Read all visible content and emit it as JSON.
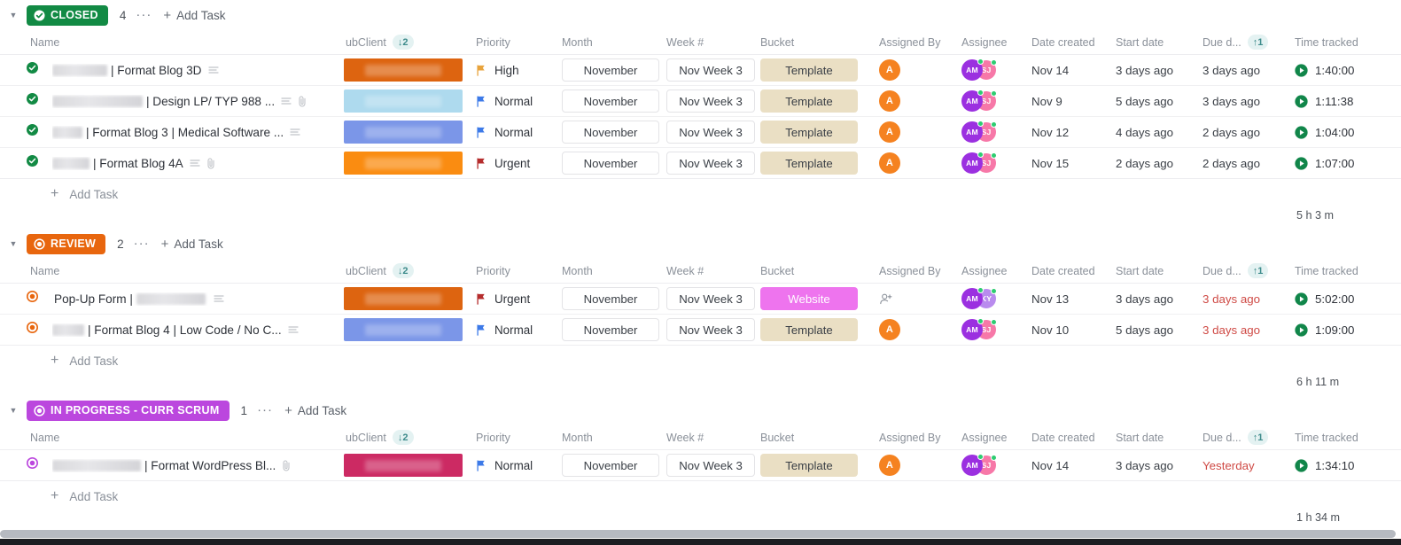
{
  "columns": {
    "name": "Name",
    "subclient": "ubClient",
    "subclient_sort": "↓2",
    "priority": "Priority",
    "month": "Month",
    "week": "Week #",
    "bucket": "Bucket",
    "assigned_by": "Assigned By",
    "assignee": "Assignee",
    "date_created": "Date created",
    "start_date": "Start date",
    "due_date": "Due d...",
    "due_sort": "↑1",
    "time_tracked": "Time tracked"
  },
  "labels": {
    "add_task": "Add Task",
    "dots": "···"
  },
  "colors": {
    "closed": "#128A44",
    "review": "#E8660E",
    "in_progress": "#BB47DE",
    "template_bucket_bg": "#EADFC4",
    "template_bucket_fg": "#3a3f46",
    "website_bucket_bg": "#EE74EE",
    "website_bucket_fg": "#ffffff",
    "overdue": "#cf4a45",
    "play_green": "#11864A",
    "sort_badge": "#3d8b8b"
  },
  "groups": [
    {
      "status": "CLOSED",
      "status_icon": "check-circle-icon",
      "count": "4",
      "total_time": "5 h 3 m",
      "tasks": [
        {
          "redact_width": 62,
          "name": "| Format Blog 3D",
          "has_description": true,
          "has_attachment": false,
          "subclient_color": "#DD6410",
          "priority": "High",
          "priority_color": "#E8A33D",
          "month": "November",
          "week": "Nov Week 3",
          "bucket": "Template",
          "bucket_type": "template",
          "assigned_by": "A",
          "assignees": [
            "AM",
            "SJ"
          ],
          "date_created": "Nov 14",
          "start_date": "3 days ago",
          "due_date": "3 days ago",
          "due_overdue": false,
          "time_tracked": "1:40:00"
        },
        {
          "redact_width": 102,
          "name": "| Design LP/ TYP 988 ...",
          "has_description": true,
          "has_attachment": true,
          "subclient_color": "#AEDAEE",
          "priority": "Normal",
          "priority_color": "#3D7AE8",
          "month": "November",
          "week": "Nov Week 3",
          "bucket": "Template",
          "bucket_type": "template",
          "assigned_by": "A",
          "assignees": [
            "AM",
            "SJ"
          ],
          "date_created": "Nov 9",
          "start_date": "5 days ago",
          "due_date": "3 days ago",
          "due_overdue": false,
          "time_tracked": "1:11:38"
        },
        {
          "redact_width": 34,
          "name": "| Format Blog 3 | Medical Software ...",
          "has_description": true,
          "has_attachment": false,
          "subclient_color": "#7B96E8",
          "priority": "Normal",
          "priority_color": "#3D7AE8",
          "month": "November",
          "week": "Nov Week 3",
          "bucket": "Template",
          "bucket_type": "template",
          "assigned_by": "A",
          "assignees": [
            "AM",
            "SJ"
          ],
          "date_created": "Nov 12",
          "start_date": "4 days ago",
          "due_date": "2 days ago",
          "due_overdue": false,
          "time_tracked": "1:04:00"
        },
        {
          "redact_width": 42,
          "name": "| Format Blog 4A",
          "has_description": true,
          "has_attachment": true,
          "subclient_color": "#FA8C11",
          "priority": "Urgent",
          "priority_color": "#B52D2D",
          "month": "November",
          "week": "Nov Week 3",
          "bucket": "Template",
          "bucket_type": "template",
          "assigned_by": "A",
          "assignees": [
            "AM",
            "SJ"
          ],
          "date_created": "Nov 15",
          "start_date": "2 days ago",
          "due_date": "2 days ago",
          "due_overdue": false,
          "time_tracked": "1:07:00"
        }
      ]
    },
    {
      "status": "REVIEW",
      "status_icon": "ring-circle-icon",
      "count": "2",
      "total_time": "6 h 11 m",
      "tasks": [
        {
          "prefix": "Pop-Up Form |",
          "redact_width": 78,
          "redact_after": true,
          "name": "",
          "has_description": true,
          "has_attachment": false,
          "subclient_color": "#DD6410",
          "priority": "Urgent",
          "priority_color": "#B52D2D",
          "month": "November",
          "week": "Nov Week 3",
          "bucket": "Website",
          "bucket_type": "website",
          "assigned_by": "",
          "assigned_by_icon": "add-person-icon",
          "assignees": [
            "AM",
            "KY"
          ],
          "date_created": "Nov 13",
          "start_date": "3 days ago",
          "due_date": "3 days ago",
          "due_overdue": true,
          "time_tracked": "5:02:00"
        },
        {
          "redact_width": 36,
          "name": "| Format Blog 4 | Low Code / No C...",
          "has_description": true,
          "has_attachment": false,
          "subclient_color": "#7B96E8",
          "priority": "Normal",
          "priority_color": "#3D7AE8",
          "month": "November",
          "week": "Nov Week 3",
          "bucket": "Template",
          "bucket_type": "template",
          "assigned_by": "A",
          "assignees": [
            "AM",
            "SJ"
          ],
          "date_created": "Nov 10",
          "start_date": "5 days ago",
          "due_date": "3 days ago",
          "due_overdue": true,
          "time_tracked": "1:09:00"
        }
      ]
    },
    {
      "status": "IN PROGRESS - CURR SCRUM",
      "status_icon": "ring-circle-icon",
      "count": "1",
      "total_time": "1 h 34 m",
      "tasks": [
        {
          "redact_width": 100,
          "name": "| Format WordPress Bl...",
          "has_description": false,
          "has_attachment": true,
          "subclient_color": "#CC2A63",
          "priority": "Normal",
          "priority_color": "#3D7AE8",
          "month": "November",
          "week": "Nov Week 3",
          "bucket": "Template",
          "bucket_type": "template",
          "assigned_by": "A",
          "assignees": [
            "AM",
            "SJ"
          ],
          "date_created": "Nov 14",
          "start_date": "3 days ago",
          "due_date": "Yesterday",
          "due_overdue": true,
          "time_tracked": "1:34:10"
        }
      ]
    }
  ]
}
